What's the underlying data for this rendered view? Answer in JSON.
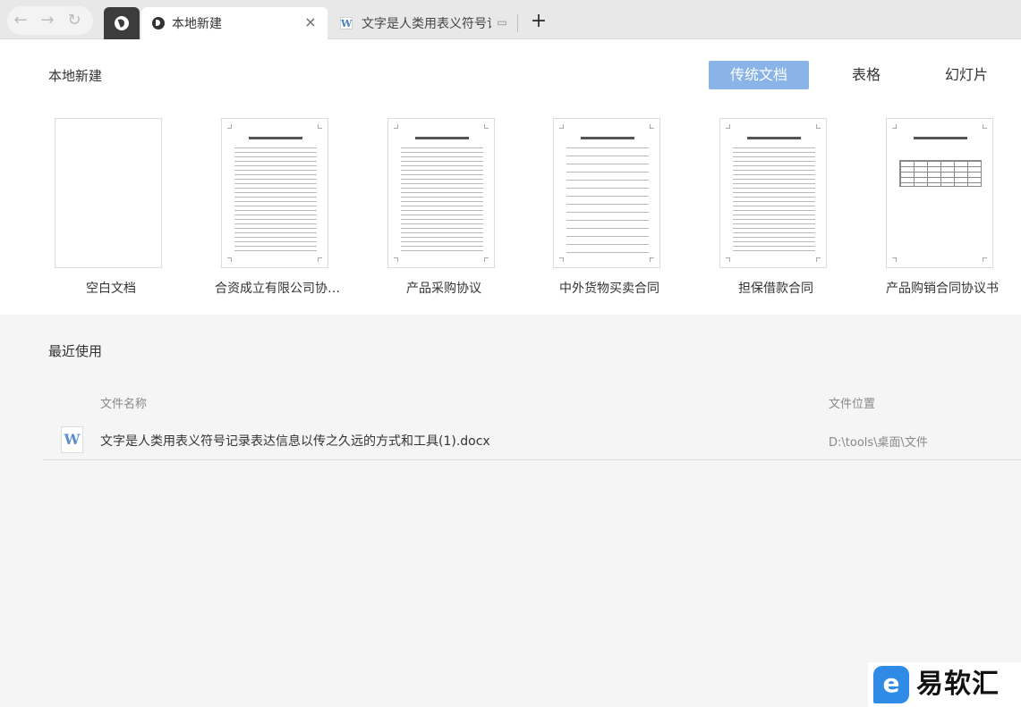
{
  "tabbar": {
    "nav": {
      "back": "←",
      "forward": "→",
      "refresh": "↻"
    },
    "tabs": [
      {
        "label": "本地新建",
        "close": "×"
      },
      {
        "label": "文字是人类用表义符号记",
        "icon": "W",
        "screen": "▭"
      }
    ],
    "new_tab": "+"
  },
  "new_section": {
    "title": "本地新建",
    "doc_types": [
      "传统文档",
      "表格",
      "幻灯片"
    ],
    "templates": [
      {
        "label": "空白文档"
      },
      {
        "label": "合资成立有限公司协…"
      },
      {
        "label": "产品采购协议"
      },
      {
        "label": "中外货物买卖合同"
      },
      {
        "label": "担保借款合同"
      },
      {
        "label": "产品购销合同协议书"
      }
    ]
  },
  "recent": {
    "title": "最近使用",
    "columns": {
      "name": "文件名称",
      "location": "文件位置"
    },
    "files": [
      {
        "icon": "W",
        "name": "文字是人类用表义符号记录表达信息以传之久远的方式和工具(1).docx",
        "location": "D:\\tools\\桌面\\文件"
      }
    ]
  },
  "watermark": {
    "icon": "e",
    "text": "易软汇"
  },
  "colors": {
    "accent": "#8ab4e8",
    "tab_dark": "#3c3c3c",
    "word_blue": "#5b8fd0"
  }
}
